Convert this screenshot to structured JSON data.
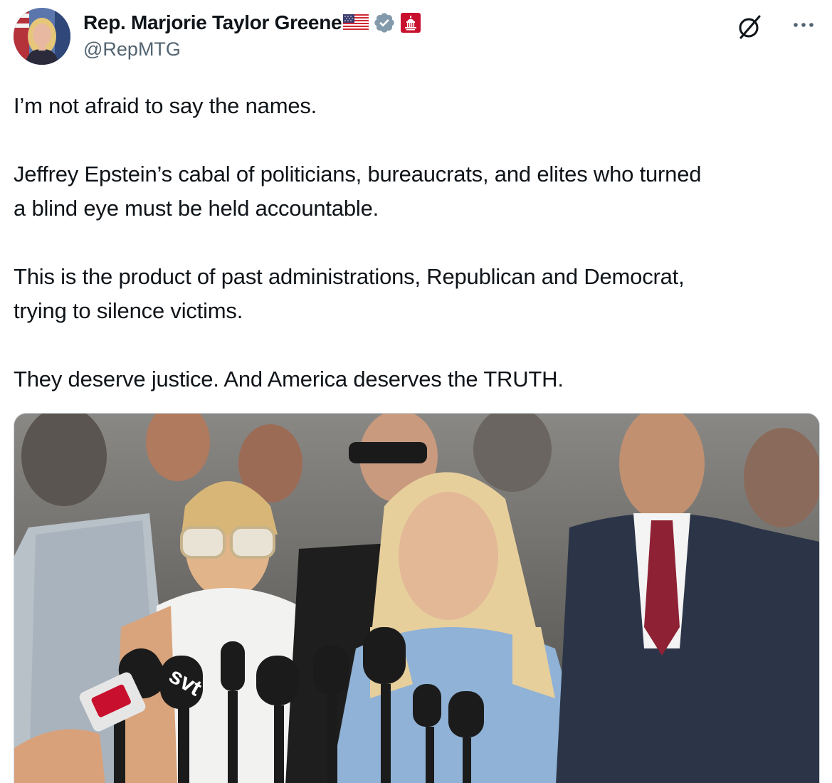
{
  "author": {
    "display_name": "Rep. Marjorie Taylor Greene",
    "handle": "@RepMTG",
    "flag_icon": "us-flag-icon",
    "verified_icon": "verified-badge-icon",
    "affiliation_icon": "us-capitol-badge-icon"
  },
  "actions": {
    "grok_icon": "grok-icon",
    "more_icon": "more-options-icon"
  },
  "tweet": {
    "paragraphs": [
      [
        "I’m not afraid to say the names."
      ],
      [
        "Jeffrey Epstein’s cabal of politicians, bureaucrats, and elites who turned",
        "a blind eye must be held accountable."
      ],
      [
        "This is the product of past administrations, Republican and Democrat,",
        "trying to silence victims."
      ],
      [
        "They deserve justice. And America deserves the TRUTH."
      ]
    ]
  },
  "media": {
    "mic_logo_text": "svt"
  },
  "colors": {
    "text": "#0f1419",
    "secondary": "#536471",
    "verified": "#829aab",
    "gov_badge": "#c8102e",
    "border": "#cfd9de"
  }
}
